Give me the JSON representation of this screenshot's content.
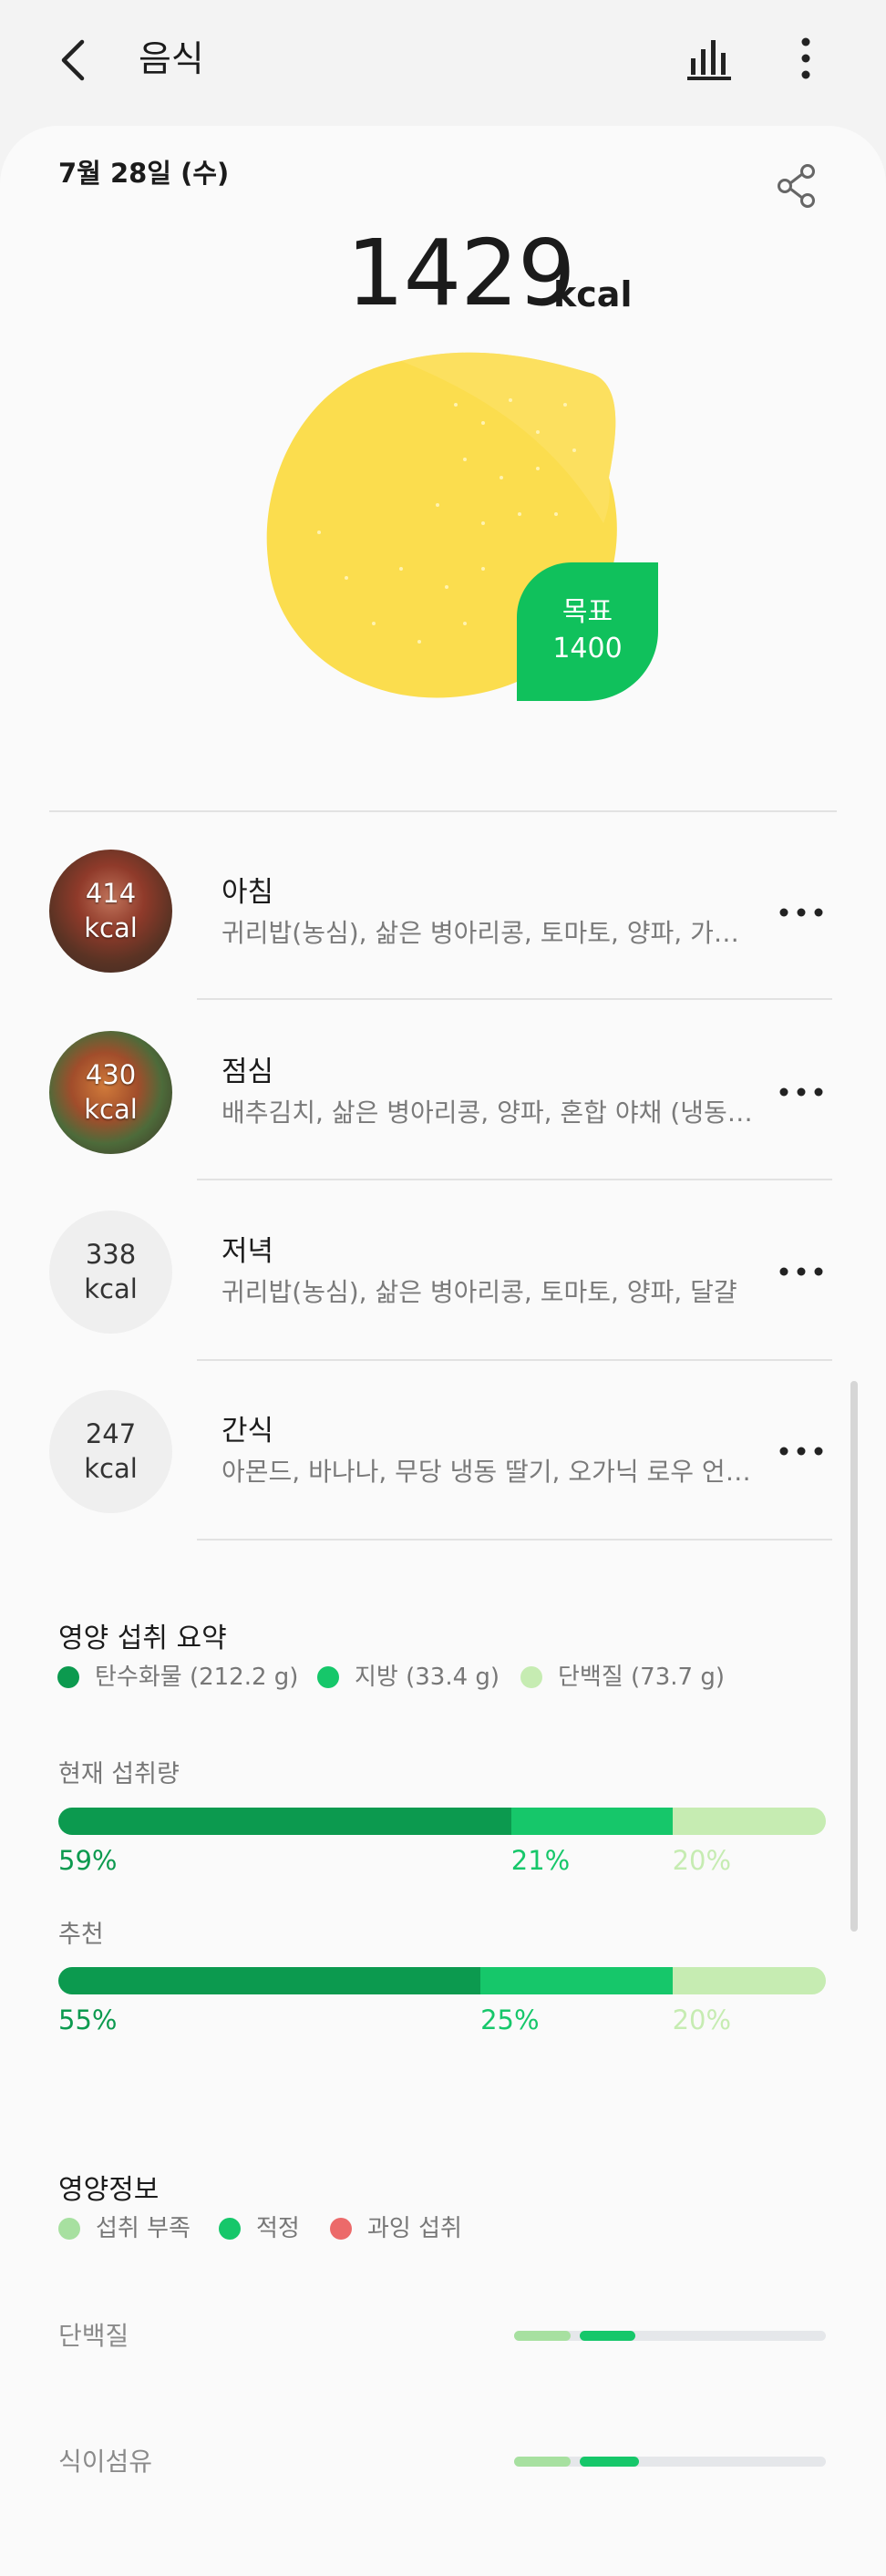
{
  "header": {
    "title": "음식",
    "back_icon": "chevron-left-icon",
    "stats_icon": "bar-chart-icon",
    "more_icon": "more-vertical-icon"
  },
  "summary": {
    "date": "7월 28일 (수)",
    "share_icon": "share-icon",
    "kcal_value": "1429",
    "kcal_unit": "kcal",
    "goal_label": "목표",
    "goal_value": "1400"
  },
  "meals": [
    {
      "kcal": "414",
      "unit": "kcal",
      "name": "아침",
      "items": "귀리밥(농심), 삶은 병아리콩, 토마토, 양파, 가자...",
      "has_photo": true
    },
    {
      "kcal": "430",
      "unit": "kcal",
      "name": "점심",
      "items": "배추김치, 삶은 병아리콩, 양파, 혼합 야채 (냉동), ...",
      "has_photo": true
    },
    {
      "kcal": "338",
      "unit": "kcal",
      "name": "저녁",
      "items": "귀리밥(농심), 삶은 병아리콩, 토마토, 양파, 달걀",
      "has_photo": false
    },
    {
      "kcal": "247",
      "unit": "kcal",
      "name": "간식",
      "items": "아몬드, 바나나, 무당 냉동 딸기, 오가닉 로우 언필...",
      "has_photo": false
    }
  ],
  "nutrition_summary": {
    "title": "영양 섭취 요약",
    "legend": [
      {
        "label": "탄수화물 (212.2 g)",
        "color": "#0c9a4f"
      },
      {
        "label": "지방 (33.4 g)",
        "color": "#16c76a"
      },
      {
        "label": "단백질 (73.7 g)",
        "color": "#c6ecb2"
      }
    ],
    "current": {
      "label": "현재 섭취량",
      "values": [
        59,
        21,
        20
      ],
      "labels": [
        "59%",
        "21%",
        "20%"
      ]
    },
    "recommended": {
      "label": "추천",
      "values": [
        55,
        25,
        20
      ],
      "labels": [
        "55%",
        "25%",
        "20%"
      ]
    },
    "pct_colors": [
      "#0c9a4f",
      "#16c76a",
      "#c6ecb2"
    ]
  },
  "nutrition_info": {
    "title": "영양정보",
    "legend": [
      {
        "label": "섭취 부족",
        "color": "#a7e0a0"
      },
      {
        "label": "적정",
        "color": "#16c76a"
      },
      {
        "label": "과잉 섭취",
        "color": "#ec6a6a"
      }
    ],
    "items": [
      {
        "label": "단백질",
        "low_fraction": 0.18,
        "ok_fraction": 0.18
      },
      {
        "label": "식이섬유",
        "low_fraction": 0.18,
        "ok_fraction": 0.19
      }
    ]
  }
}
